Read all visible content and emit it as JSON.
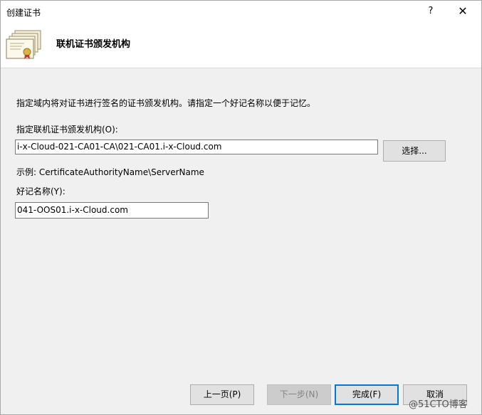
{
  "window": {
    "title": "创建证书",
    "help_label": "?",
    "close_label": "✕"
  },
  "header": {
    "title": "联机证书颁发机构",
    "icon": "certificate-icon"
  },
  "content": {
    "description": "指定域内将对证书进行签名的证书颁发机构。请指定一个好记名称以便于记忆。",
    "ca_label": "指定联机证书颁发机构(O):",
    "ca_value": "i-x-Cloud-021-CA01-CA\\021-CA01.i-x-Cloud.com",
    "select_button": "选择...",
    "example": "示例: CertificateAuthorityName\\ServerName",
    "friendly_label": "好记名称(Y):",
    "friendly_value": "041-OOS01.i-x-Cloud.com"
  },
  "footer": {
    "prev_button": "上一页(P)",
    "next_button": "下一步(N)",
    "finish_button": "完成(F)",
    "cancel_button": "取消"
  },
  "watermark": "@51CTO博客"
}
